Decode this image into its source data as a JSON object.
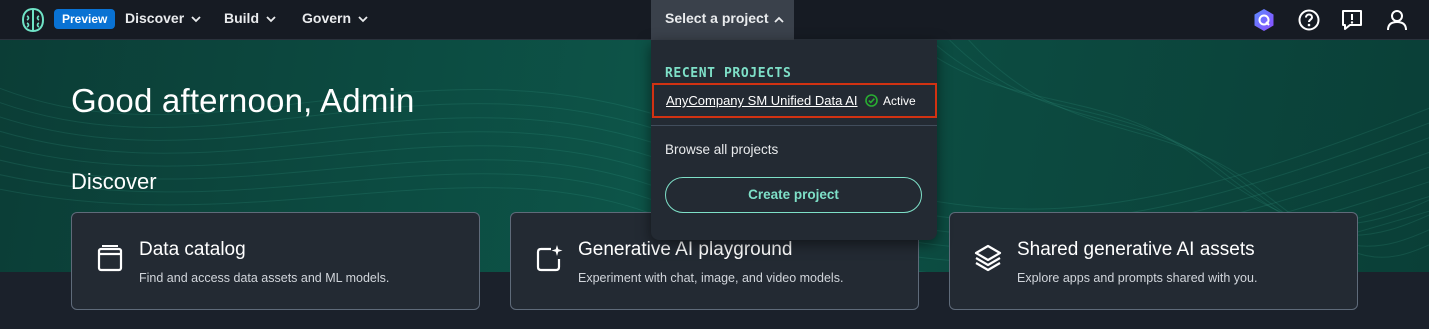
{
  "nav": {
    "badge": "Preview",
    "items": [
      {
        "label": "Discover"
      },
      {
        "label": "Build"
      },
      {
        "label": "Govern"
      }
    ],
    "project_selector": "Select a project"
  },
  "main": {
    "greeting": "Good afternoon, Admin",
    "section_title": "Discover",
    "cards": [
      {
        "title": "Data catalog",
        "description": "Find and access data assets and ML models.",
        "icon": "data-catalog-icon"
      },
      {
        "title": "Generative AI playground",
        "description": "Experiment with chat, image, and video models.",
        "icon": "playground-sparkle-icon"
      },
      {
        "title": "Shared generative AI assets",
        "description": "Explore apps and prompts shared with you.",
        "icon": "layers-icon"
      }
    ]
  },
  "dropdown": {
    "heading": "RECENT PROJECTS",
    "recent_project": {
      "name": "AnyCompany SM Unified Data AI",
      "status": "Active"
    },
    "browse_all": "Browse all projects",
    "create_button": "Create project"
  },
  "colors": {
    "nav_bg": "#161b23",
    "hero_bg": "#0d5448",
    "accent": "#7ee0c8",
    "highlight_border": "#d13212",
    "badge": "#0972d3"
  }
}
